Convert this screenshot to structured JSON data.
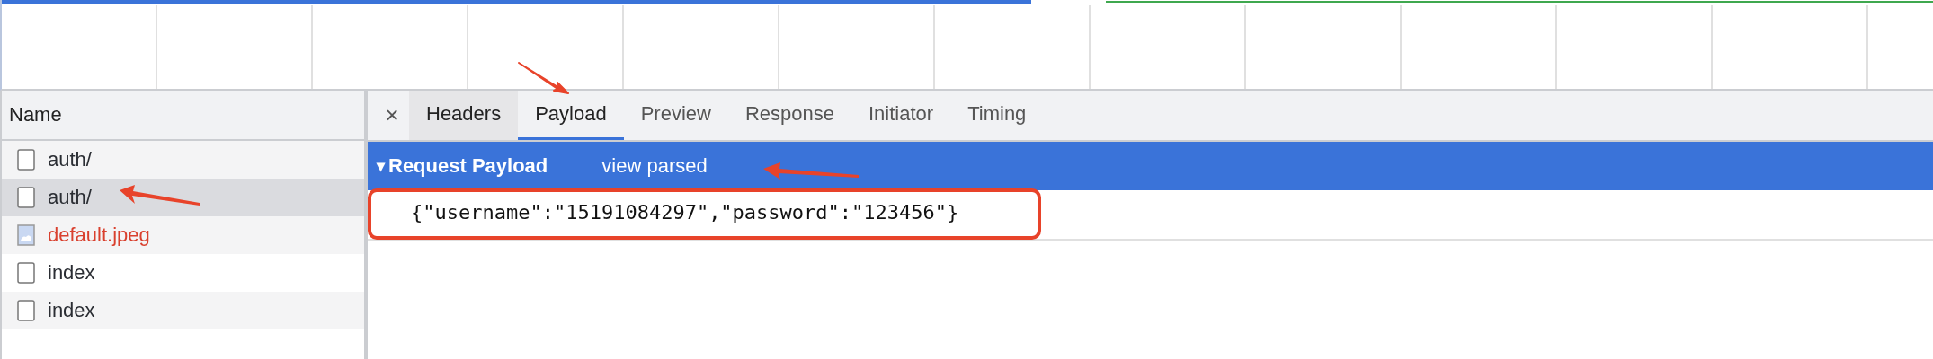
{
  "requests": {
    "header": "Name",
    "rows": [
      {
        "name": "auth/",
        "kind": "document",
        "selected": false,
        "failed": false
      },
      {
        "name": "auth/",
        "kind": "document",
        "selected": true,
        "failed": false
      },
      {
        "name": "default.jpeg",
        "kind": "image",
        "selected": false,
        "failed": true
      },
      {
        "name": "index",
        "kind": "document",
        "selected": false,
        "failed": false
      },
      {
        "name": "index",
        "kind": "document",
        "selected": false,
        "failed": false
      }
    ]
  },
  "details": {
    "close": "×",
    "tabs": [
      {
        "label": "Headers",
        "selected": false,
        "hovered": true
      },
      {
        "label": "Payload",
        "selected": true,
        "hovered": false
      },
      {
        "label": "Preview",
        "selected": false,
        "hovered": false
      },
      {
        "label": "Response",
        "selected": false,
        "hovered": false
      },
      {
        "label": "Initiator",
        "selected": false,
        "hovered": false
      },
      {
        "label": "Timing",
        "selected": false,
        "hovered": false
      }
    ],
    "section": {
      "toggle": "▾",
      "title": "Request Payload",
      "expanded": true,
      "link": "view parsed",
      "body": "{\"username\":\"15191084297\",\"password\":\"123456\"}"
    }
  }
}
